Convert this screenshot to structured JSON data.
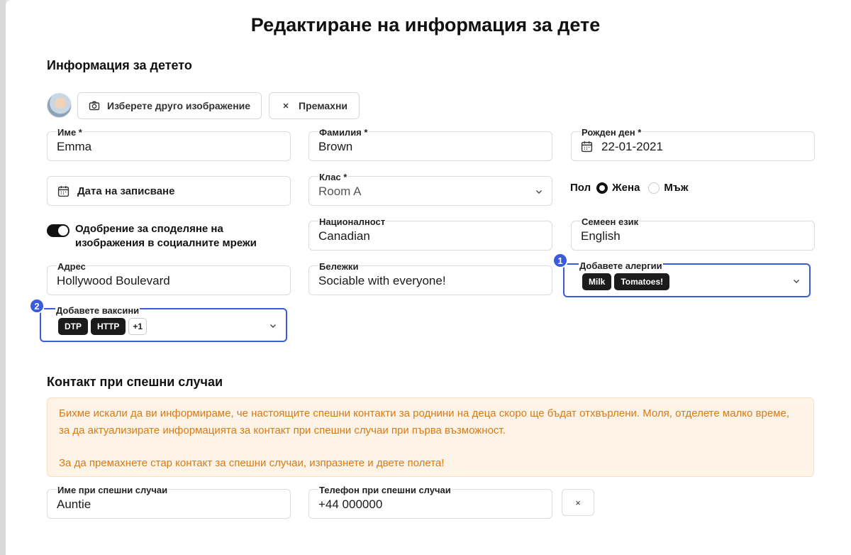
{
  "title": "Редактиране на информация за дете",
  "child_info": {
    "section_title": "Информация за детето",
    "choose_image_label": "Изберете друго изображение",
    "remove_label": "Премахни"
  },
  "fields": {
    "first_name": {
      "label": "Име *",
      "value": "Emma"
    },
    "last_name": {
      "label": "Фамилия *",
      "value": "Brown"
    },
    "birthday": {
      "label": "Рожден ден *",
      "value": "22-01-2021"
    },
    "enrollment_date": {
      "label": "Дата на записване"
    },
    "class": {
      "label": "Клас *",
      "value": "Room A"
    },
    "gender": {
      "label": "Пол",
      "options": [
        "Жена",
        "Мъж"
      ],
      "selected": "Жена"
    },
    "social_consent": {
      "label": "Одобрение за споделяне на изображения в социалните мрежи",
      "enabled": true
    },
    "nationality": {
      "label": "Националност",
      "value": "Canadian"
    },
    "family_language": {
      "label": "Семеен език",
      "value": "English"
    },
    "address": {
      "label": "Адрес",
      "value": "Hollywood Boulevard"
    },
    "notes": {
      "label": "Бележки",
      "value": "Sociable with everyone!"
    },
    "allergies": {
      "label": "Добавете алергии",
      "tags": [
        "Milk",
        "Tomatoes!"
      ]
    },
    "vaccines": {
      "label": "Добавете ваксини",
      "tags": [
        "DTP",
        "HTTP"
      ],
      "more": "+1"
    }
  },
  "badges": {
    "allergies": "1",
    "vaccines": "2"
  },
  "emergency": {
    "section_title": "Контакт при спешни случаи",
    "notice_line1": "Бихме искали да ви информираме, че настоящите спешни контакти за роднини на деца скоро ще бъдат отхвърлени. Моля, отделете малко време, за да актуализирате информацията за контакт при спешни случаи при първа възможност.",
    "notice_line2": "За да премахнете стар контакт за спешни случаи, изпразнете и двете полета!",
    "name": {
      "label": "Име при спешни случаи",
      "value": "Auntie"
    },
    "phone": {
      "label": "Телефон при спешни случаи",
      "value": "+44 000000"
    },
    "remove_symbol": "×"
  },
  "colors": {
    "accent": "#3b5bdb",
    "notice_text": "#d97a16",
    "notice_bg": "#fdf3e6"
  }
}
